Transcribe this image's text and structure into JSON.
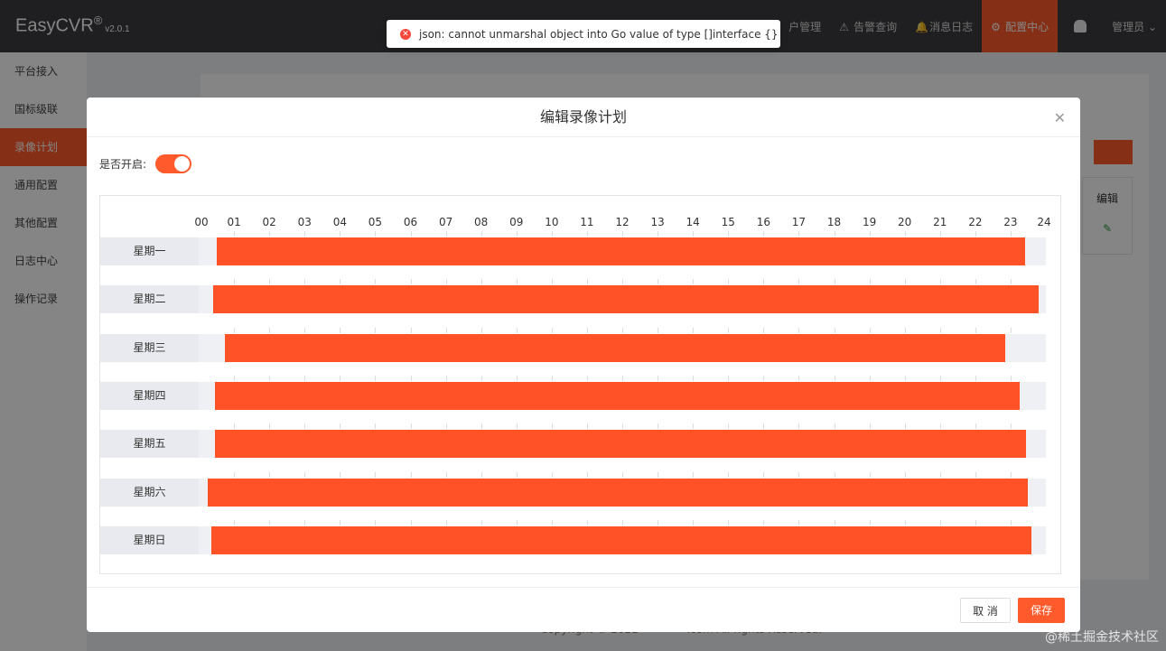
{
  "app": {
    "name": "EasyCVR",
    "trademark": "®",
    "version": "v2.0.1"
  },
  "nav": {
    "items": [
      {
        "label": "户管理",
        "icon": "user-icon"
      },
      {
        "label": "告警查询",
        "icon": "alarm-icon"
      },
      {
        "label": "消息日志",
        "icon": "bell-icon"
      },
      {
        "label": "配置中心",
        "icon": "gear-icon",
        "active": true
      }
    ],
    "user": "管理员 ⌄"
  },
  "sidebar": {
    "items": [
      {
        "label": "平台接入"
      },
      {
        "label": "国标级联"
      },
      {
        "label": "录像计划",
        "active": true
      },
      {
        "label": "通用配置"
      },
      {
        "label": "其他配置"
      },
      {
        "label": "日志中心"
      },
      {
        "label": "操作记录"
      }
    ]
  },
  "background": {
    "edit_header": "编辑",
    "footer": "Copyright © 2021 ·············.com All rights Reserved."
  },
  "toast": {
    "message": "json: cannot unmarshal object into Go value of type []interface {}"
  },
  "modal": {
    "title": "编辑录像计划",
    "enable_label": "是否开启:",
    "enabled": true,
    "hours": [
      "00",
      "01",
      "02",
      "03",
      "04",
      "05",
      "06",
      "07",
      "08",
      "09",
      "10",
      "11",
      "12",
      "13",
      "14",
      "15",
      "16",
      "17",
      "18",
      "19",
      "20",
      "21",
      "22",
      "23",
      "24"
    ],
    "days": [
      {
        "label": "星期一",
        "start": 0.5,
        "end": 23.4
      },
      {
        "label": "星期二",
        "start": 0.4,
        "end": 23.8
      },
      {
        "label": "星期三",
        "start": 0.75,
        "end": 22.85
      },
      {
        "label": "星期四",
        "start": 0.45,
        "end": 23.25
      },
      {
        "label": "星期五",
        "start": 0.45,
        "end": 23.45
      },
      {
        "label": "星期六",
        "start": 0.25,
        "end": 23.5
      },
      {
        "label": "星期日",
        "start": 0.35,
        "end": 23.6
      }
    ],
    "cancel_label": "取 消",
    "save_label": "保存"
  },
  "colors": {
    "accent": "#ff5a2b",
    "bar": "#ff5226",
    "topbar": "#3c3d40"
  },
  "watermark": "@稀土掘金技术社区"
}
